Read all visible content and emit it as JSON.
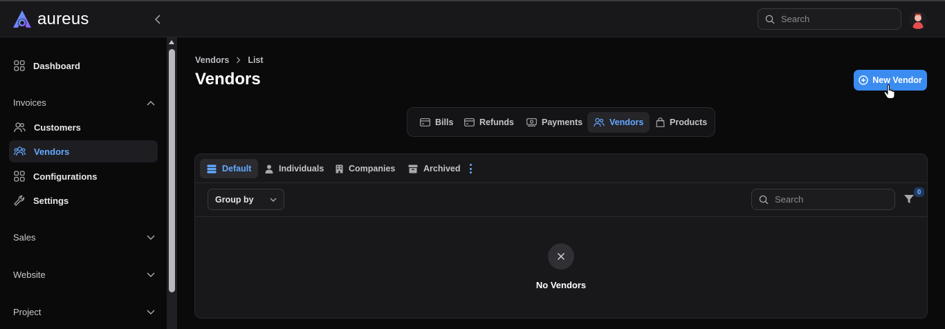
{
  "app": {
    "name": "aureus",
    "brand_color": "#3b8cf0"
  },
  "header": {
    "search_placeholder": "Search",
    "icons": [
      "chevron-left-icon",
      "search-icon",
      "avatar"
    ]
  },
  "sidebar": {
    "items": [
      {
        "label": "Dashboard",
        "icon": "grid-icon"
      },
      {
        "label": "Customers",
        "icon": "users-icon"
      },
      {
        "label": "Vendors",
        "icon": "users-icon",
        "active": true
      },
      {
        "label": "Configurations",
        "icon": "grid-icon"
      },
      {
        "label": "Settings",
        "icon": "wrench-icon"
      }
    ],
    "groups": [
      {
        "label": "Invoices",
        "expanded": true
      },
      {
        "label": "Sales"
      },
      {
        "label": "Website"
      },
      {
        "label": "Project"
      }
    ]
  },
  "breadcrumb": {
    "root": "Vendors",
    "current": "List"
  },
  "page": {
    "title": "Vendors",
    "new_button": "New Vendor"
  },
  "nav_tabs": [
    {
      "label": "Bills",
      "icon": "card-icon"
    },
    {
      "label": "Refunds",
      "icon": "card-icon"
    },
    {
      "label": "Payments",
      "icon": "cash-icon"
    },
    {
      "label": "Vendors",
      "icon": "users-icon",
      "active": true
    },
    {
      "label": "Products",
      "icon": "bag-icon"
    }
  ],
  "views": [
    {
      "label": "Default",
      "icon": "stack-icon",
      "active": true
    },
    {
      "label": "Individuals",
      "icon": "user-icon"
    },
    {
      "label": "Companies",
      "icon": "building-icon"
    },
    {
      "label": "Archived",
      "icon": "archive-icon"
    }
  ],
  "toolbar": {
    "group_by": "Group by",
    "search_placeholder": "Search",
    "filter_count": "0"
  },
  "empty_state": {
    "text": "No Vendors"
  },
  "colors": {
    "accent": "#64a8ff",
    "background": "#0a0a0b",
    "panel": "#18181b"
  }
}
